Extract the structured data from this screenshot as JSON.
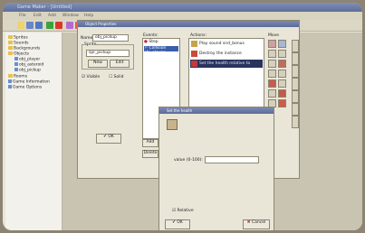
{
  "app": {
    "title": "Game Maker - [Untitled]",
    "menu": [
      "File",
      "Edit",
      "Add",
      "Window",
      "Help"
    ]
  },
  "tree": [
    {
      "label": "Sprites",
      "kind": "folder",
      "level": 0
    },
    {
      "label": "Sounds",
      "kind": "folder",
      "level": 0
    },
    {
      "label": "Backgrounds",
      "kind": "folder",
      "level": 0
    },
    {
      "label": "Objects",
      "kind": "folder",
      "level": 0
    },
    {
      "label": "obj_player",
      "kind": "res",
      "level": 1
    },
    {
      "label": "obj_asteroid",
      "kind": "res",
      "level": 1
    },
    {
      "label": "obj_pickup",
      "kind": "res",
      "level": 1
    },
    {
      "label": "Rooms",
      "kind": "folder",
      "level": 0
    },
    {
      "label": "Game Information",
      "kind": "res",
      "level": 0
    },
    {
      "label": "Game Options",
      "kind": "res",
      "level": 0
    }
  ],
  "object_window": {
    "title": "Object Properties",
    "name_label": "Name:",
    "name_value": "obj_pickup",
    "sprite_label": "Sprite",
    "sprite_value": "spr_pickup",
    "new_button": "New",
    "edit_button": "Edit",
    "visible_label": "Visible",
    "solid_label": "Solid",
    "ok_button": "OK",
    "events_label": "Events:",
    "events": [
      "Step",
      "Collision obj_player"
    ],
    "add_event_button": "Add",
    "delete_button": "Delete",
    "actions_label": "Actions:",
    "actions": [
      "Play sound snd_bonus",
      "Destroy the instance",
      "Set the health relative to"
    ],
    "move_label": "Move"
  },
  "dialog": {
    "title": "Set the health",
    "value_label": "value (0-100):",
    "value": "",
    "relative_label": "Relative",
    "ok_button": "OK",
    "cancel_button": "Cancel"
  }
}
